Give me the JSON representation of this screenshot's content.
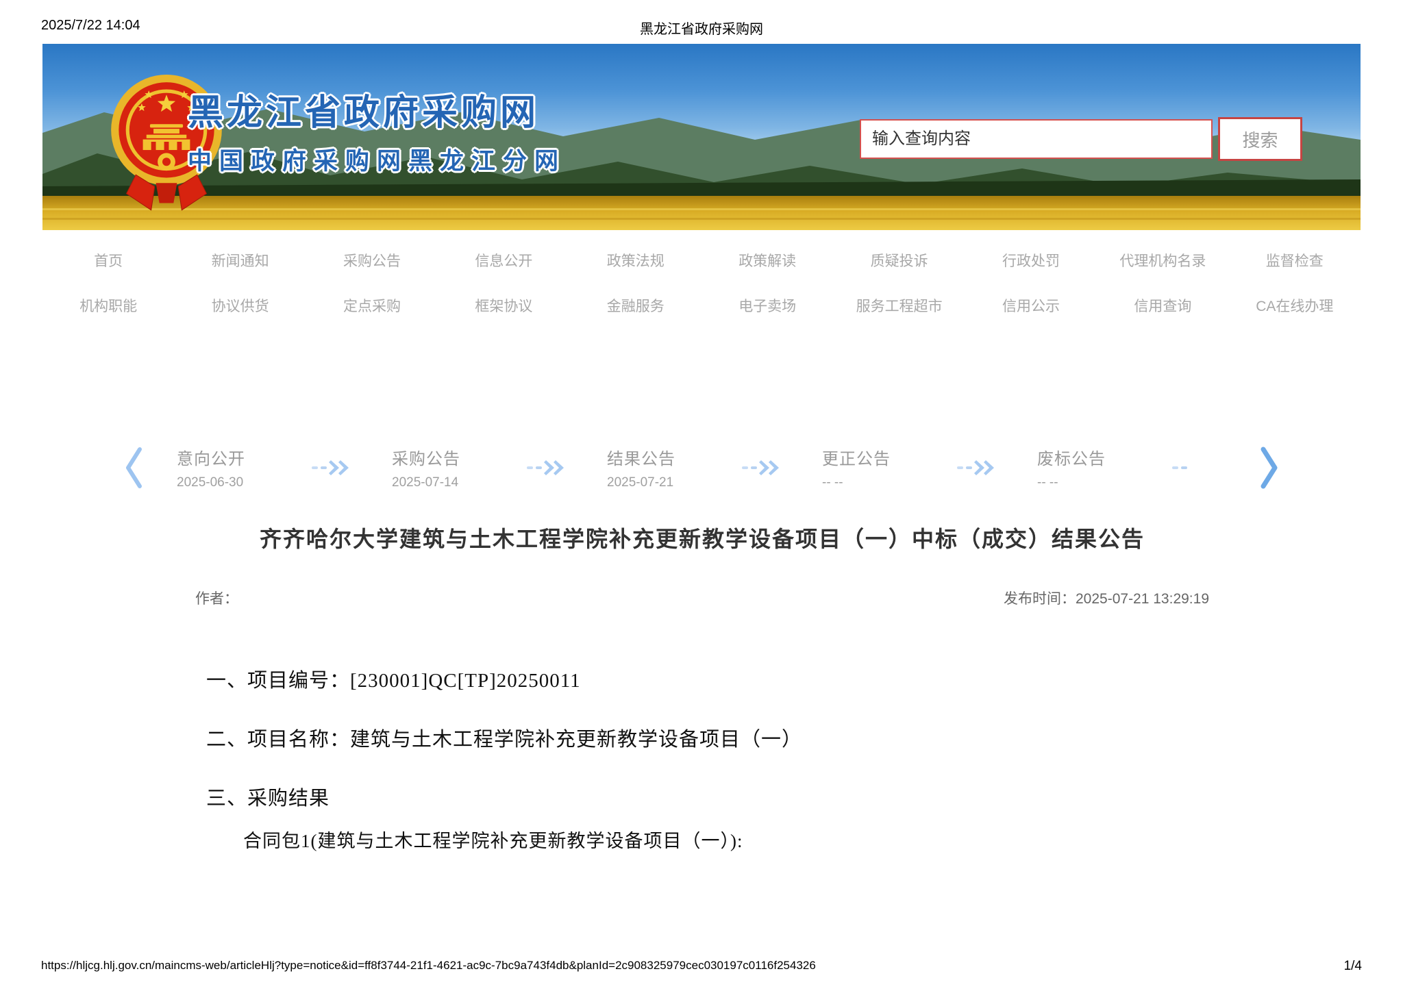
{
  "print_header": {
    "datetime": "2025/7/22 14:04",
    "title": "黑龙江省政府采购网"
  },
  "banner": {
    "site_title": "黑龙江省政府采购网",
    "site_subtitle": "中国政府采购网黑龙江分网",
    "search": {
      "placeholder": "输入查询内容",
      "button_label": "搜索"
    }
  },
  "nav": {
    "row1": [
      "首页",
      "新闻通知",
      "采购公告",
      "信息公开",
      "政策法规",
      "政策解读",
      "质疑投诉",
      "行政处罚",
      "代理机构名录",
      "监督检查"
    ],
    "row2": [
      "机构职能",
      "协议供货",
      "定点采购",
      "框架协议",
      "金融服务",
      "电子卖场",
      "服务工程超市",
      "信用公示",
      "信用查询",
      "CA在线办理"
    ]
  },
  "timeline": {
    "steps": [
      {
        "label": "意向公开",
        "date": "2025-06-30"
      },
      {
        "label": "采购公告",
        "date": "2025-07-14"
      },
      {
        "label": "结果公告",
        "date": "2025-07-21"
      },
      {
        "label": "更正公告",
        "date": "-- --"
      },
      {
        "label": "废标公告",
        "date": "-- --"
      }
    ]
  },
  "icons": {
    "timeline_prev": "chevron-left",
    "timeline_next": "chevron-right",
    "step_arrow": "double-chevron-right",
    "logo": "china-national-emblem"
  },
  "article": {
    "title": "齐齐哈尔大学建筑与土木工程学院补充更新教学设备项目（一）中标（成交）结果公告",
    "author_label": "作者：",
    "publish_text": "发布时间：2025-07-21 13:29:19",
    "paragraphs": [
      "一、项目编号：[230001]QC[TP]20250011",
      "二、项目名称：建筑与土木工程学院补充更新教学设备项目（一）",
      "三、采购结果",
      "合同包1(建筑与土木工程学院补充更新教学设备项目（一）):"
    ]
  },
  "print_footer": {
    "url": "https://hljcg.hlj.gov.cn/maincms-web/articleHlj?type=notice&id=ff8f3744-21f1-4621-ac9c-7bc9a743f4db&planId=2c908325979cec030197c0116f254326",
    "page": "1/4"
  },
  "colors": {
    "accent_red": "#c64543",
    "banner_title_blue": "#2465b4",
    "nav_gray": "#a8a8a8",
    "timeline_blue": "#a6c9f1",
    "title_dark": "#333333",
    "field_gold": "#d9ad25",
    "mountain_green": "#32502d"
  }
}
